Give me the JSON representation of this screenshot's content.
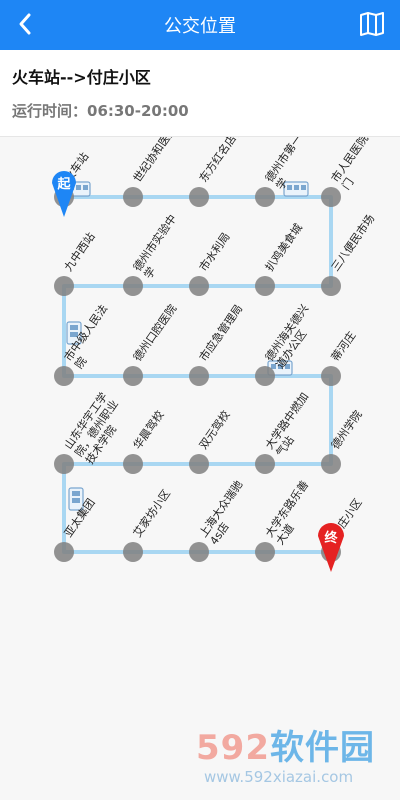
{
  "header": {
    "title": "公交位置",
    "back_icon": "chevron-left-icon",
    "map_icon": "map-book-icon"
  },
  "route": {
    "name": "火车站-->付庄小区",
    "time_label": "运行时间：06:30-20:00"
  },
  "stations": [
    "火车站",
    "世纪协和医院",
    "东方红名店街",
    "德州市第一中学",
    "市人民医院北门",
    "三八便民市场",
    "扒鸡美食城",
    "市水利局",
    "德州市实验中学",
    "九中西站",
    "市中级人民法院",
    "德州口腔医院",
    "市应急管理局",
    "德州海关德兴道办公区",
    "蒂河庄",
    "德州学院",
    "大学路中燃加气站",
    "双元驾校",
    "华晨驾校",
    "山东华宇工学院，德州职业技术学院",
    "亚太集团",
    "艾家坊小区",
    "上海大众瑞驰4s店",
    "大学东路乐善大道",
    "付庄小区"
  ],
  "markers": {
    "start": "起",
    "end": "终"
  },
  "colors": {
    "primary": "#1e86f5",
    "route_line": "#a9d7f2",
    "stop_dot": "#808080",
    "end_marker": "#e52222",
    "start_marker": "#1e86f5"
  },
  "watermark": {
    "logo_num": "592",
    "logo_text": "软件园",
    "url": "www.592xiazai.com"
  }
}
